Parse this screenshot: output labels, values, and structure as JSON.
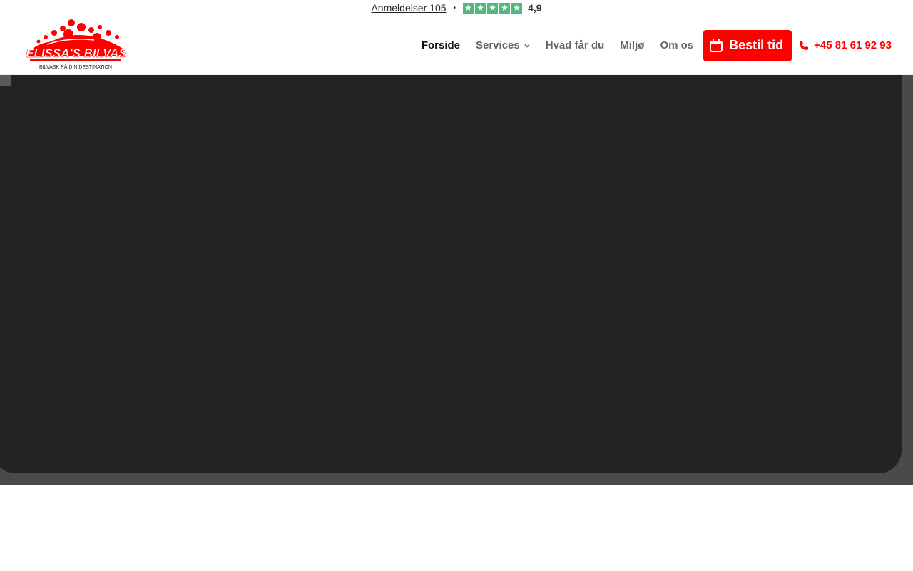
{
  "reviews": {
    "link_text": "Anmeldelser 105",
    "separator": "•",
    "rating": "4,9",
    "star_count": 5,
    "star_glyph": "★",
    "star_color": "#52b77e"
  },
  "logo": {
    "title": "MELISSA'S BILVASK",
    "tagline": "BILVASK PÅ DIN DESTINATION",
    "color": "#ff0000"
  },
  "nav": {
    "items": [
      {
        "label": "Forside",
        "active": true
      },
      {
        "label": "Services",
        "has_dropdown": true,
        "icon": "chevron-down-icon"
      },
      {
        "label": "Hvad får du"
      },
      {
        "label": "Miljø"
      },
      {
        "label": "Om os"
      }
    ],
    "book_button": {
      "label": "Bestil tid",
      "icon": "calendar-icon"
    },
    "phone": {
      "label": "+45 81 61 92 93",
      "icon": "phone-icon"
    }
  },
  "colors": {
    "brand": "#ff0000",
    "hero_bg": "#4a4a4a",
    "video_bg": "#232323"
  }
}
